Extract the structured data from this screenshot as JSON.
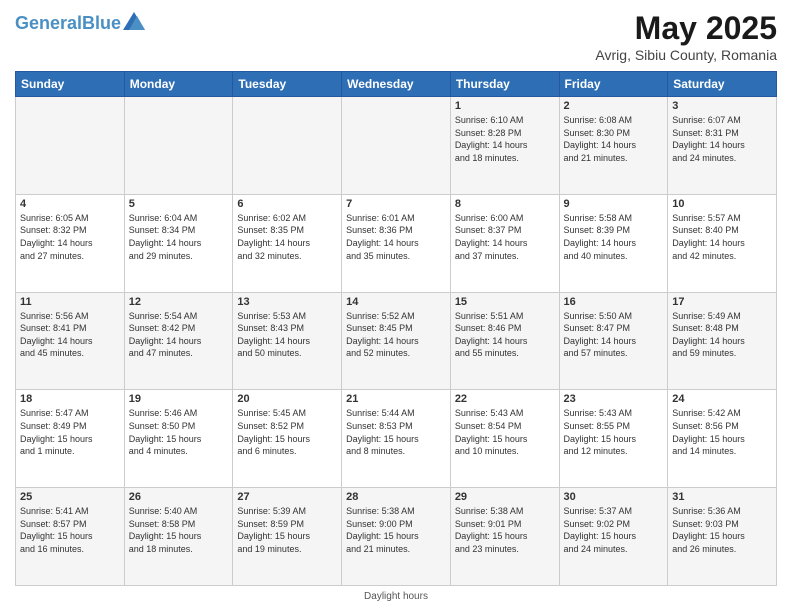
{
  "header": {
    "logo_text1": "General",
    "logo_text2": "Blue",
    "title": "May 2025",
    "subtitle": "Avrig, Sibiu County, Romania"
  },
  "days_of_week": [
    "Sunday",
    "Monday",
    "Tuesday",
    "Wednesday",
    "Thursday",
    "Friday",
    "Saturday"
  ],
  "weeks": [
    [
      {
        "day": "",
        "info": ""
      },
      {
        "day": "",
        "info": ""
      },
      {
        "day": "",
        "info": ""
      },
      {
        "day": "",
        "info": ""
      },
      {
        "day": "1",
        "info": "Sunrise: 6:10 AM\nSunset: 8:28 PM\nDaylight: 14 hours\nand 18 minutes."
      },
      {
        "day": "2",
        "info": "Sunrise: 6:08 AM\nSunset: 8:30 PM\nDaylight: 14 hours\nand 21 minutes."
      },
      {
        "day": "3",
        "info": "Sunrise: 6:07 AM\nSunset: 8:31 PM\nDaylight: 14 hours\nand 24 minutes."
      }
    ],
    [
      {
        "day": "4",
        "info": "Sunrise: 6:05 AM\nSunset: 8:32 PM\nDaylight: 14 hours\nand 27 minutes."
      },
      {
        "day": "5",
        "info": "Sunrise: 6:04 AM\nSunset: 8:34 PM\nDaylight: 14 hours\nand 29 minutes."
      },
      {
        "day": "6",
        "info": "Sunrise: 6:02 AM\nSunset: 8:35 PM\nDaylight: 14 hours\nand 32 minutes."
      },
      {
        "day": "7",
        "info": "Sunrise: 6:01 AM\nSunset: 8:36 PM\nDaylight: 14 hours\nand 35 minutes."
      },
      {
        "day": "8",
        "info": "Sunrise: 6:00 AM\nSunset: 8:37 PM\nDaylight: 14 hours\nand 37 minutes."
      },
      {
        "day": "9",
        "info": "Sunrise: 5:58 AM\nSunset: 8:39 PM\nDaylight: 14 hours\nand 40 minutes."
      },
      {
        "day": "10",
        "info": "Sunrise: 5:57 AM\nSunset: 8:40 PM\nDaylight: 14 hours\nand 42 minutes."
      }
    ],
    [
      {
        "day": "11",
        "info": "Sunrise: 5:56 AM\nSunset: 8:41 PM\nDaylight: 14 hours\nand 45 minutes."
      },
      {
        "day": "12",
        "info": "Sunrise: 5:54 AM\nSunset: 8:42 PM\nDaylight: 14 hours\nand 47 minutes."
      },
      {
        "day": "13",
        "info": "Sunrise: 5:53 AM\nSunset: 8:43 PM\nDaylight: 14 hours\nand 50 minutes."
      },
      {
        "day": "14",
        "info": "Sunrise: 5:52 AM\nSunset: 8:45 PM\nDaylight: 14 hours\nand 52 minutes."
      },
      {
        "day": "15",
        "info": "Sunrise: 5:51 AM\nSunset: 8:46 PM\nDaylight: 14 hours\nand 55 minutes."
      },
      {
        "day": "16",
        "info": "Sunrise: 5:50 AM\nSunset: 8:47 PM\nDaylight: 14 hours\nand 57 minutes."
      },
      {
        "day": "17",
        "info": "Sunrise: 5:49 AM\nSunset: 8:48 PM\nDaylight: 14 hours\nand 59 minutes."
      }
    ],
    [
      {
        "day": "18",
        "info": "Sunrise: 5:47 AM\nSunset: 8:49 PM\nDaylight: 15 hours\nand 1 minute."
      },
      {
        "day": "19",
        "info": "Sunrise: 5:46 AM\nSunset: 8:50 PM\nDaylight: 15 hours\nand 4 minutes."
      },
      {
        "day": "20",
        "info": "Sunrise: 5:45 AM\nSunset: 8:52 PM\nDaylight: 15 hours\nand 6 minutes."
      },
      {
        "day": "21",
        "info": "Sunrise: 5:44 AM\nSunset: 8:53 PM\nDaylight: 15 hours\nand 8 minutes."
      },
      {
        "day": "22",
        "info": "Sunrise: 5:43 AM\nSunset: 8:54 PM\nDaylight: 15 hours\nand 10 minutes."
      },
      {
        "day": "23",
        "info": "Sunrise: 5:43 AM\nSunset: 8:55 PM\nDaylight: 15 hours\nand 12 minutes."
      },
      {
        "day": "24",
        "info": "Sunrise: 5:42 AM\nSunset: 8:56 PM\nDaylight: 15 hours\nand 14 minutes."
      }
    ],
    [
      {
        "day": "25",
        "info": "Sunrise: 5:41 AM\nSunset: 8:57 PM\nDaylight: 15 hours\nand 16 minutes."
      },
      {
        "day": "26",
        "info": "Sunrise: 5:40 AM\nSunset: 8:58 PM\nDaylight: 15 hours\nand 18 minutes."
      },
      {
        "day": "27",
        "info": "Sunrise: 5:39 AM\nSunset: 8:59 PM\nDaylight: 15 hours\nand 19 minutes."
      },
      {
        "day": "28",
        "info": "Sunrise: 5:38 AM\nSunset: 9:00 PM\nDaylight: 15 hours\nand 21 minutes."
      },
      {
        "day": "29",
        "info": "Sunrise: 5:38 AM\nSunset: 9:01 PM\nDaylight: 15 hours\nand 23 minutes."
      },
      {
        "day": "30",
        "info": "Sunrise: 5:37 AM\nSunset: 9:02 PM\nDaylight: 15 hours\nand 24 minutes."
      },
      {
        "day": "31",
        "info": "Sunrise: 5:36 AM\nSunset: 9:03 PM\nDaylight: 15 hours\nand 26 minutes."
      }
    ]
  ],
  "footer": "Daylight hours"
}
